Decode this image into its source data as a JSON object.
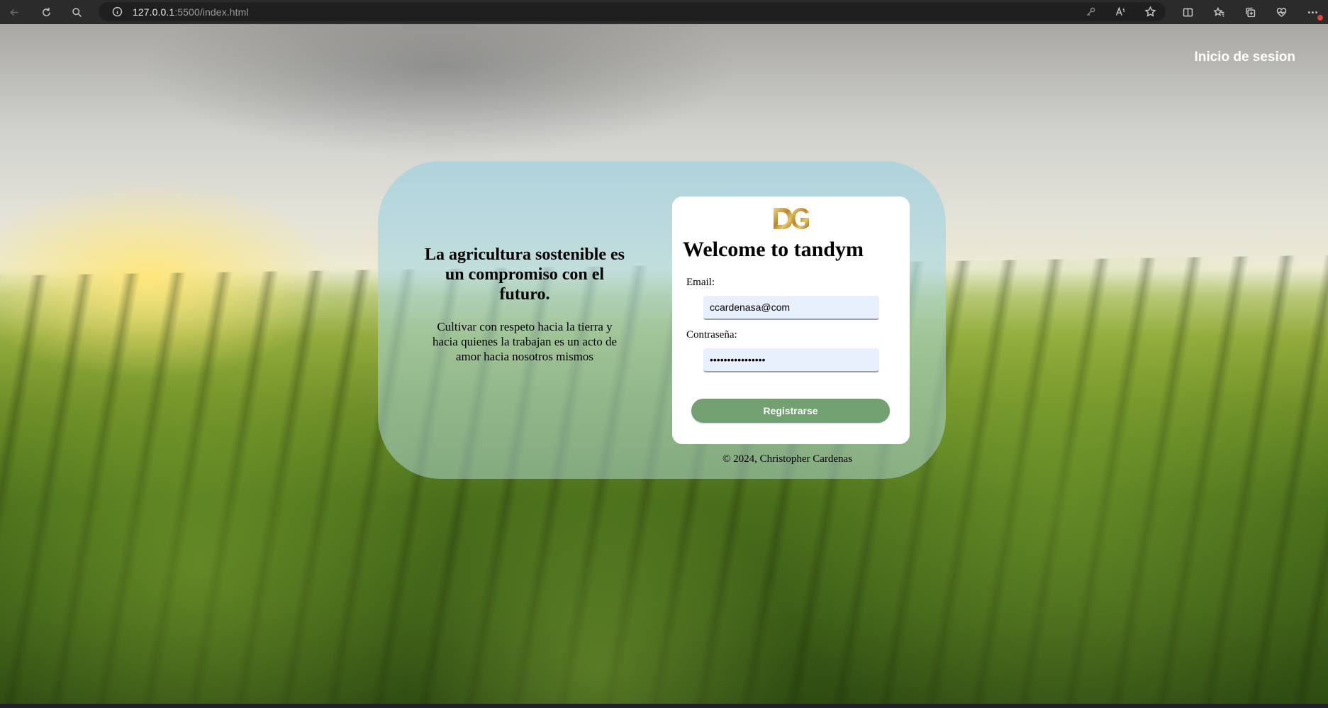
{
  "browser": {
    "url_host": "127.0.0.1",
    "url_rest": ":5500/index.html"
  },
  "header": {
    "login_link": "Inicio de sesion"
  },
  "hero": {
    "title": "La agricultura sostenible es un compromiso con el futuro.",
    "text": "Cultivar con respeto hacia la tierra y hacia quienes la trabajan es un acto de amor hacia nosotros mismos"
  },
  "form": {
    "title": "Welcome to tandym",
    "email_label": "Email:",
    "email_value": "ccardenasa@com",
    "password_label": "Contraseña:",
    "password_value": "••••••••••••••••",
    "submit_label": "Registrarse"
  },
  "footer": {
    "text": "© 2024, Christopher Cardenas"
  },
  "colors": {
    "button": "#73a070",
    "input_bg": "#e8f0fe",
    "card_bg": "#a0d2e1",
    "logo_gold": "#c9a23a"
  }
}
